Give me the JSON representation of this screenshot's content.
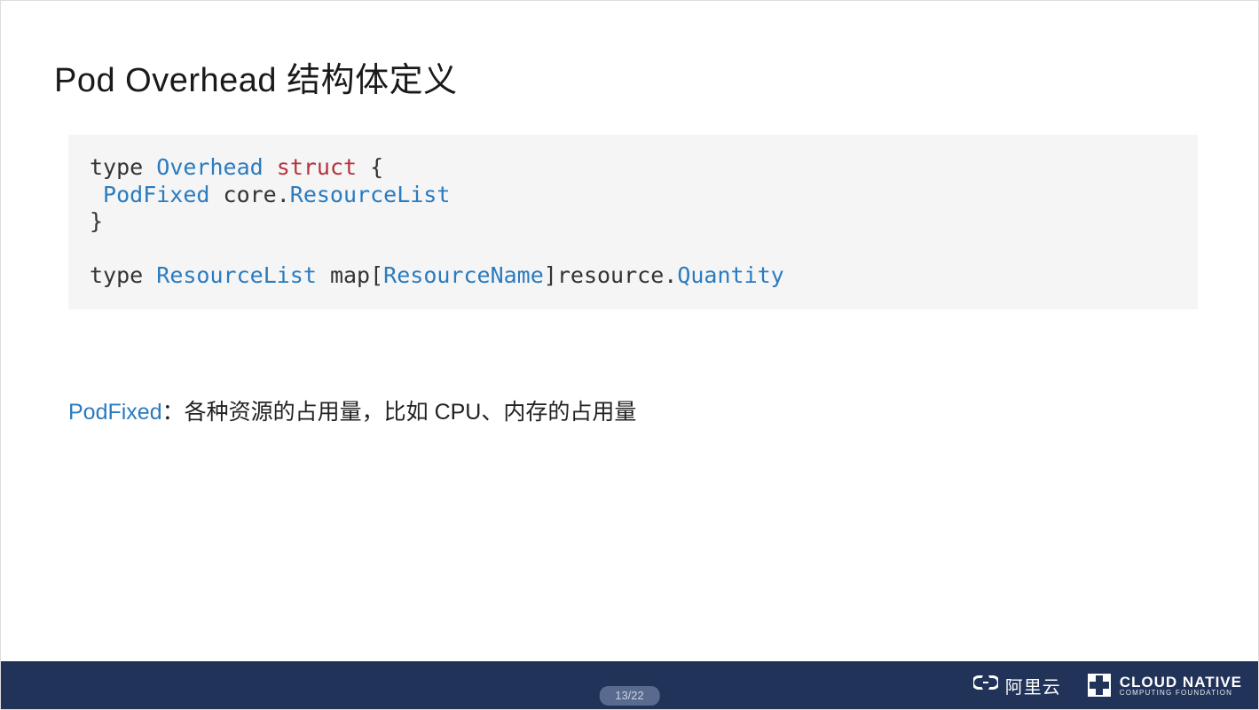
{
  "title": "Pod Overhead 结构体定义",
  "code": {
    "l1_keyword": "type",
    "l1_name": "Overhead",
    "l1_struct": "struct",
    "l1_brace": " {",
    "l2_field": " PodFixed",
    "l2_pkg": " core.",
    "l2_type": "ResourceList",
    "l3": "}",
    "l4": "",
    "l5_keyword": "type",
    "l5_name": "ResourceList",
    "l5_map_prefix": " map[",
    "l5_key": "ResourceName",
    "l5_map_suffix": "]resource.",
    "l5_val": "Quantity"
  },
  "desc": {
    "highlight": "PodFixed",
    "rest": "：各种资源的占用量，比如 CPU、内存的占用量"
  },
  "footer": {
    "page": "13/22",
    "ali_text": "阿里云",
    "cncf_big": "CLOUD NATIVE",
    "cncf_small": "COMPUTING FOUNDATION"
  }
}
